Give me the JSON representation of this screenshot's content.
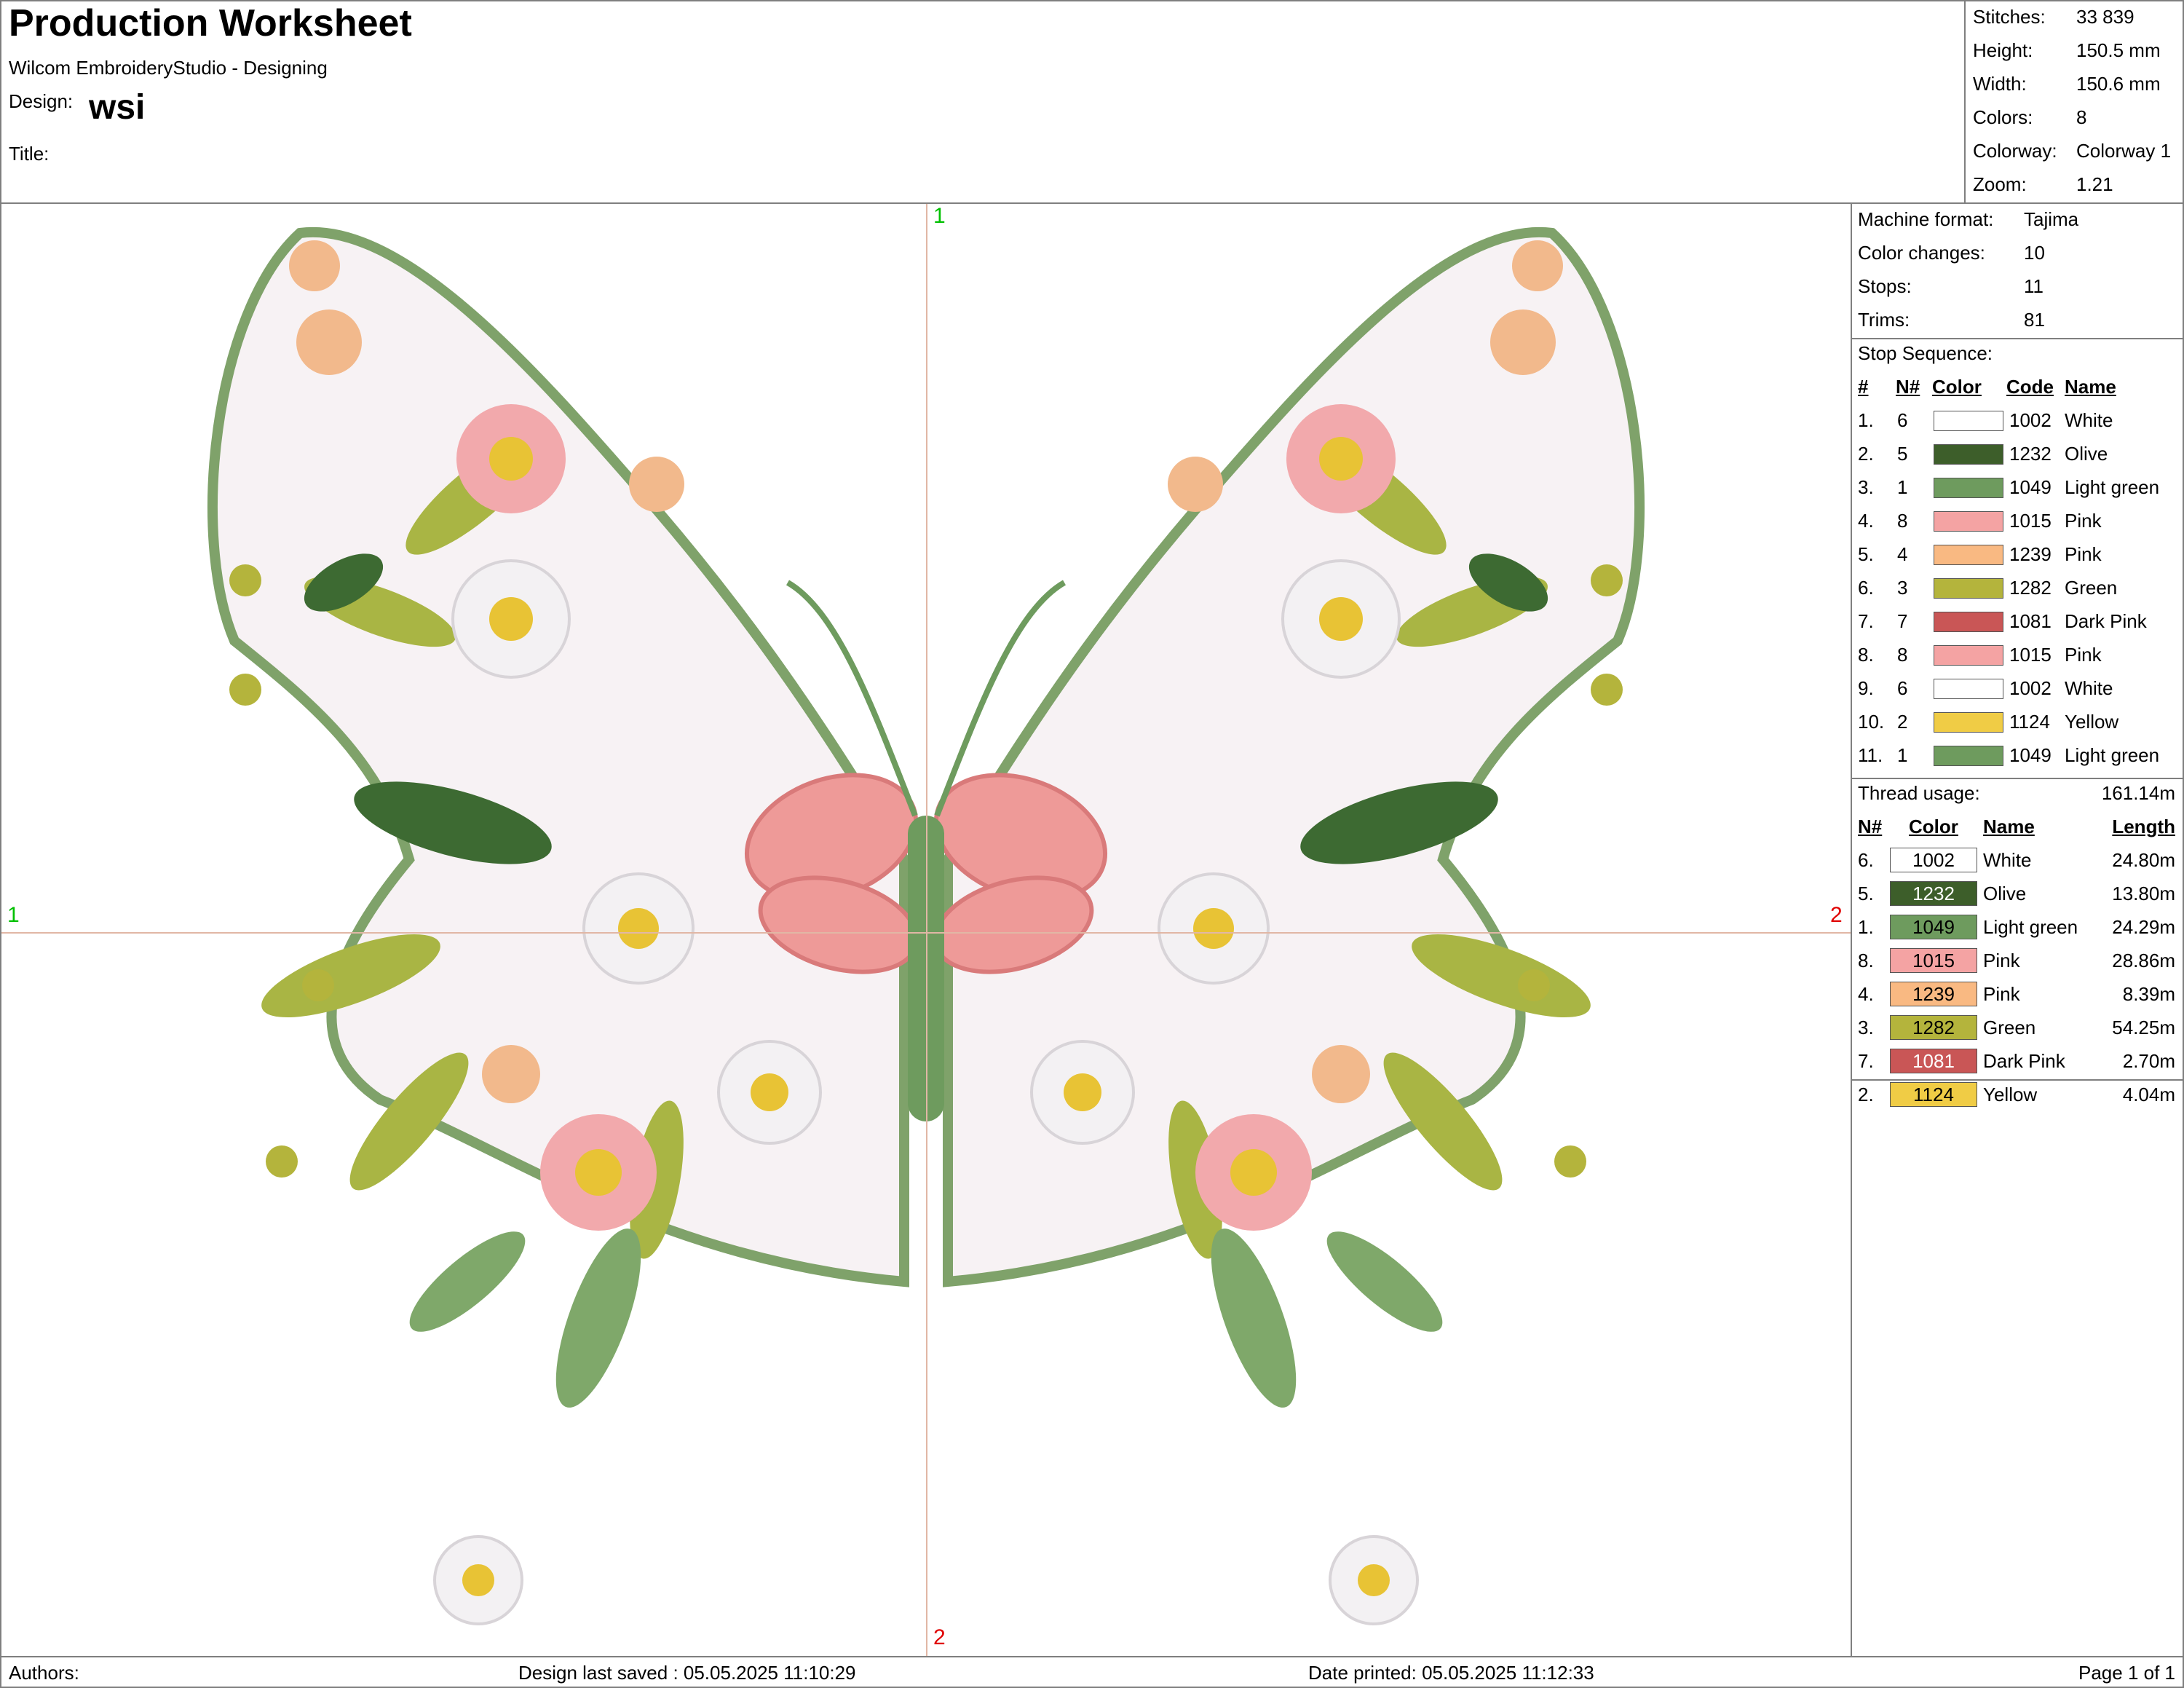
{
  "header": {
    "worksheet_title": "Production Worksheet",
    "app_name": "Wilcom EmbroideryStudio - Designing",
    "design_label": "Design:",
    "design_name": "wsi",
    "title_label": "Title:"
  },
  "stats": [
    {
      "label": "Stitches:",
      "value": "33 839"
    },
    {
      "label": "Height:",
      "value": "150.5 mm"
    },
    {
      "label": "Width:",
      "value": "150.6 mm"
    },
    {
      "label": "Colors:",
      "value": "8"
    },
    {
      "label": "Colorway:",
      "value": "Colorway 1"
    },
    {
      "label": "Zoom:",
      "value": "1.21"
    }
  ],
  "canvas": {
    "marker_top": "1",
    "marker_left": "1",
    "marker_right": "2",
    "marker_bottom": "2"
  },
  "machine": [
    {
      "label": "Machine format:",
      "value": "Tajima"
    },
    {
      "label": "Color changes:",
      "value": "10"
    },
    {
      "label": "Stops:",
      "value": "11"
    },
    {
      "label": "Trims:",
      "value": "81"
    }
  ],
  "stop_sequence": {
    "title": "Stop Sequence:",
    "headers": {
      "idx": "#",
      "n": "N#",
      "color": "Color",
      "code": "Code",
      "name": "Name"
    },
    "rows": [
      {
        "idx": "1.",
        "n": "6",
        "hex": "#ffffff",
        "code": "1002",
        "name": "White"
      },
      {
        "idx": "2.",
        "n": "5",
        "hex": "#3d5e2a",
        "code": "1232",
        "name": "Olive"
      },
      {
        "idx": "3.",
        "n": "1",
        "hex": "#6e9b5e",
        "code": "1049",
        "name": "Light green"
      },
      {
        "idx": "4.",
        "n": "8",
        "hex": "#f4a3a3",
        "code": "1015",
        "name": "Pink"
      },
      {
        "idx": "5.",
        "n": "4",
        "hex": "#f9b982",
        "code": "1239",
        "name": "Pink"
      },
      {
        "idx": "6.",
        "n": "3",
        "hex": "#b4b43c",
        "code": "1282",
        "name": "Green"
      },
      {
        "idx": "7.",
        "n": "7",
        "hex": "#c95656",
        "code": "1081",
        "name": "Dark Pink"
      },
      {
        "idx": "8.",
        "n": "8",
        "hex": "#f4a3a3",
        "code": "1015",
        "name": "Pink"
      },
      {
        "idx": "9.",
        "n": "6",
        "hex": "#ffffff",
        "code": "1002",
        "name": "White"
      },
      {
        "idx": "10.",
        "n": "2",
        "hex": "#f0cc45",
        "code": "1124",
        "name": "Yellow"
      },
      {
        "idx": "11.",
        "n": "1",
        "hex": "#6e9b5e",
        "code": "1049",
        "name": "Light green"
      }
    ]
  },
  "thread_usage": {
    "title": "Thread usage:",
    "total": "161.14m",
    "headers": {
      "n": "N#",
      "color": "Color",
      "name": "Name",
      "length": "Length"
    },
    "rows": [
      {
        "n": "6.",
        "hex": "#ffffff",
        "text_color": "#000000",
        "code": "1002",
        "name": "White",
        "length": "24.80m"
      },
      {
        "n": "5.",
        "hex": "#3d5e2a",
        "text_color": "#ffffff",
        "code": "1232",
        "name": "Olive",
        "length": "13.80m"
      },
      {
        "n": "1.",
        "hex": "#6e9b5e",
        "text_color": "#000000",
        "code": "1049",
        "name": "Light green",
        "length": "24.29m"
      },
      {
        "n": "8.",
        "hex": "#f4a3a3",
        "text_color": "#000000",
        "code": "1015",
        "name": "Pink",
        "length": "28.86m"
      },
      {
        "n": "4.",
        "hex": "#f9b982",
        "text_color": "#000000",
        "code": "1239",
        "name": "Pink",
        "length": "8.39m"
      },
      {
        "n": "3.",
        "hex": "#b4b43c",
        "text_color": "#000000",
        "code": "1282",
        "name": "Green",
        "length": "54.25m"
      },
      {
        "n": "7.",
        "hex": "#c95656",
        "text_color": "#ffffff",
        "code": "1081",
        "name": "Dark Pink",
        "length": "2.70m"
      },
      {
        "n": "2.",
        "hex": "#f0cc45",
        "text_color": "#000000",
        "code": "1124",
        "name": "Yellow",
        "length": "4.04m"
      }
    ]
  },
  "footer": {
    "authors": "Authors:",
    "saved": "Design last saved : 05.05.2025 11:10:29",
    "printed": "Date printed: 05.05.2025 11:12:33",
    "page": "Page 1 of 1"
  }
}
